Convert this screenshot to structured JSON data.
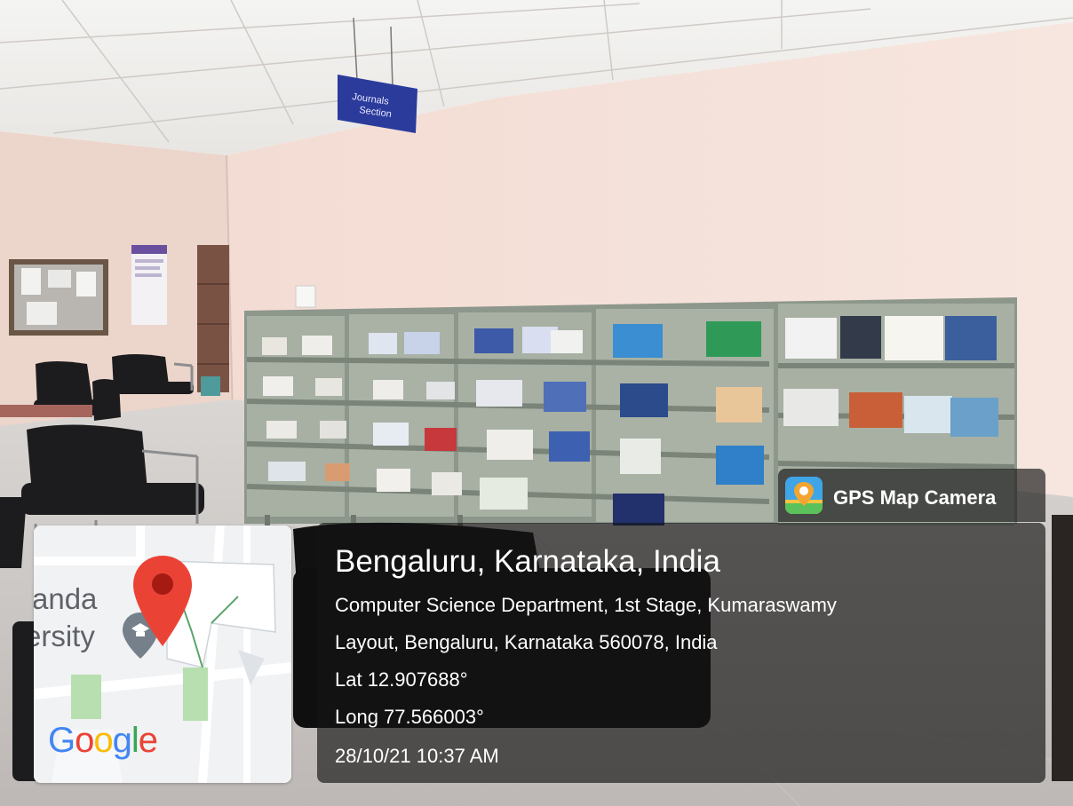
{
  "scene": {
    "sign_line_1": "Journals",
    "sign_line_2": "Section"
  },
  "app_badge": {
    "icon": "map-pin-camera-icon",
    "name": "GPS Map Camera"
  },
  "map_thumbnail": {
    "place_label_1": "anda",
    "place_label_2": "ersity",
    "provider_logo": "Google",
    "marker_icon": "red-location-pin-icon",
    "poi_icon": "graduation-cap-icon"
  },
  "location": {
    "title": "Bengaluru, Karnataka, India",
    "address_line_1": "Computer Science Department, 1st Stage, Kumaraswamy",
    "address_line_2": "Layout, Bengaluru, Karnataka 560078, India",
    "latitude": "Lat 12.907688°",
    "longitude": "Long 77.566003°",
    "datetime": "28/10/21 10:37 AM"
  },
  "colors": {
    "overlay": "#141414",
    "pin_red": "#ea4335",
    "google_blue": "#4285f4",
    "google_red": "#ea4335",
    "google_yellow": "#fbbc05",
    "google_green": "#34a853",
    "sign_blue": "#2b3b9c"
  }
}
